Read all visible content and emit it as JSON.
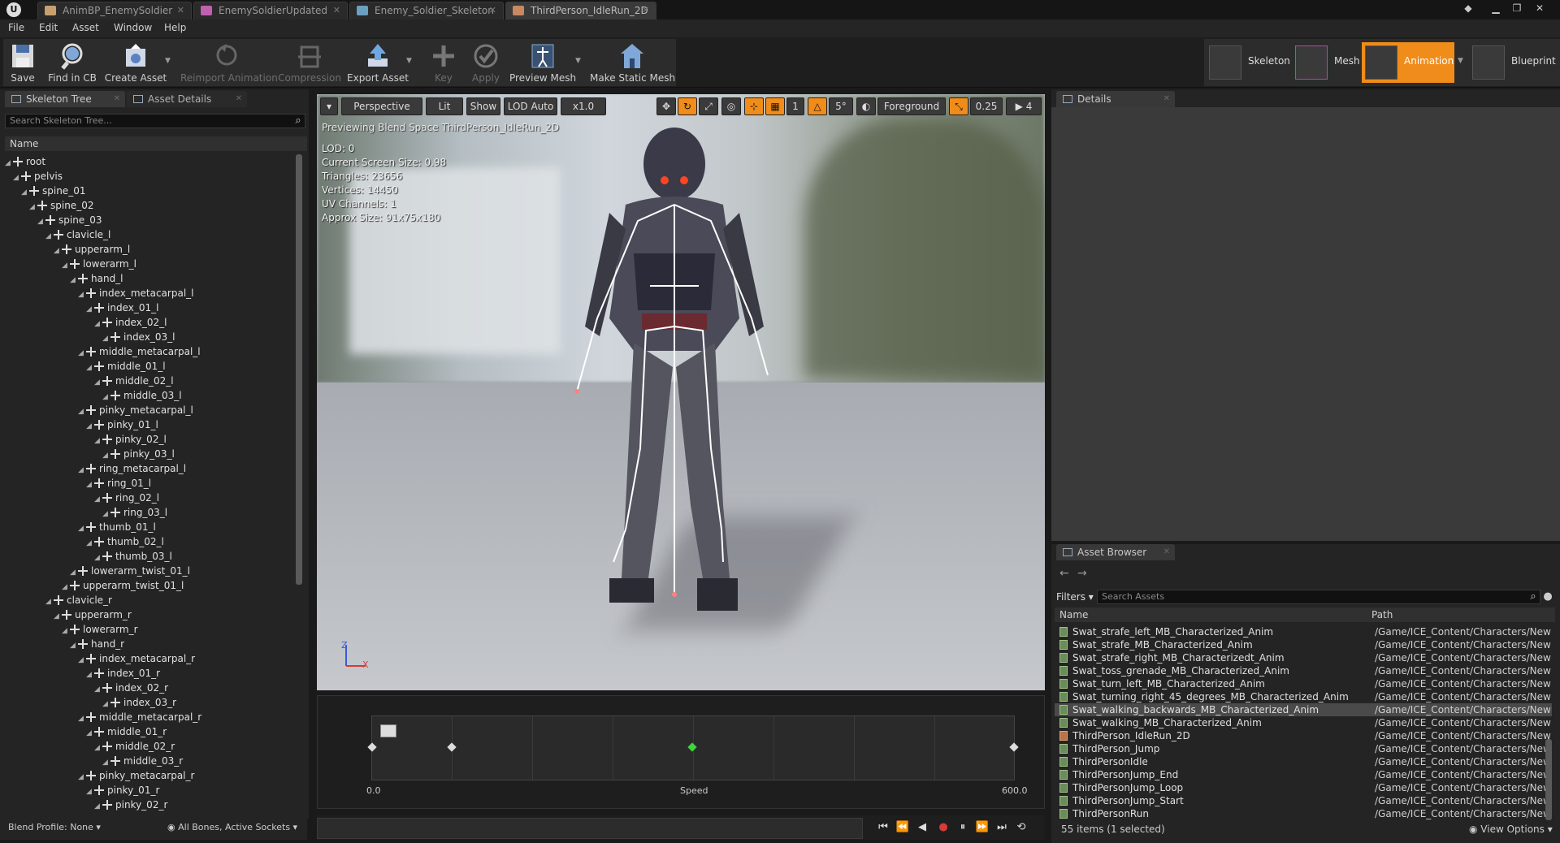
{
  "tabs": [
    {
      "label": "AnimBP_EnemySoldier",
      "color": "#c8a070"
    },
    {
      "label": "EnemySoldierUpdated",
      "color": "#c060b0"
    },
    {
      "label": "Enemy_Soldier_Skeleton",
      "color": "#6aa0c0"
    },
    {
      "label": "ThirdPerson_IdleRun_2D",
      "color": "#c88860"
    }
  ],
  "menu": [
    "File",
    "Edit",
    "Asset",
    "Window",
    "Help"
  ],
  "toolbar": {
    "save": "Save",
    "find_in_cb": "Find in CB",
    "create_asset": "Create Asset",
    "reimport": "Reimport Animation",
    "compression": "Compression",
    "export": "Export Asset",
    "key": "Key",
    "apply": "Apply",
    "preview_mesh": "Preview Mesh",
    "make_static_mesh": "Make Static Mesh"
  },
  "modes": {
    "skeleton": "Skeleton",
    "mesh": "Mesh",
    "animation": "Animation",
    "blueprint": "Blueprint"
  },
  "left_panel": {
    "tab_skeleton_tree": "Skeleton Tree",
    "tab_asset_details": "Asset Details",
    "search_placeholder": "Search Skeleton Tree...",
    "column_name": "Name",
    "bones": [
      {
        "name": "root",
        "depth": 0
      },
      {
        "name": "pelvis",
        "depth": 1
      },
      {
        "name": "spine_01",
        "depth": 2
      },
      {
        "name": "spine_02",
        "depth": 3
      },
      {
        "name": "spine_03",
        "depth": 4
      },
      {
        "name": "clavicle_l",
        "depth": 5
      },
      {
        "name": "upperarm_l",
        "depth": 6
      },
      {
        "name": "lowerarm_l",
        "depth": 7
      },
      {
        "name": "hand_l",
        "depth": 8
      },
      {
        "name": "index_metacarpal_l",
        "depth": 9
      },
      {
        "name": "index_01_l",
        "depth": 10
      },
      {
        "name": "index_02_l",
        "depth": 11
      },
      {
        "name": "index_03_l",
        "depth": 12
      },
      {
        "name": "middle_metacarpal_l",
        "depth": 9
      },
      {
        "name": "middle_01_l",
        "depth": 10
      },
      {
        "name": "middle_02_l",
        "depth": 11
      },
      {
        "name": "middle_03_l",
        "depth": 12
      },
      {
        "name": "pinky_metacarpal_l",
        "depth": 9
      },
      {
        "name": "pinky_01_l",
        "depth": 10
      },
      {
        "name": "pinky_02_l",
        "depth": 11
      },
      {
        "name": "pinky_03_l",
        "depth": 12
      },
      {
        "name": "ring_metacarpal_l",
        "depth": 9
      },
      {
        "name": "ring_01_l",
        "depth": 10
      },
      {
        "name": "ring_02_l",
        "depth": 11
      },
      {
        "name": "ring_03_l",
        "depth": 12
      },
      {
        "name": "thumb_01_l",
        "depth": 9
      },
      {
        "name": "thumb_02_l",
        "depth": 10
      },
      {
        "name": "thumb_03_l",
        "depth": 11
      },
      {
        "name": "lowerarm_twist_01_l",
        "depth": 8
      },
      {
        "name": "upperarm_twist_01_l",
        "depth": 7
      },
      {
        "name": "clavicle_r",
        "depth": 5
      },
      {
        "name": "upperarm_r",
        "depth": 6
      },
      {
        "name": "lowerarm_r",
        "depth": 7
      },
      {
        "name": "hand_r",
        "depth": 8
      },
      {
        "name": "index_metacarpal_r",
        "depth": 9
      },
      {
        "name": "index_01_r",
        "depth": 10
      },
      {
        "name": "index_02_r",
        "depth": 11
      },
      {
        "name": "index_03_r",
        "depth": 12
      },
      {
        "name": "middle_metacarpal_r",
        "depth": 9
      },
      {
        "name": "middle_01_r",
        "depth": 10
      },
      {
        "name": "middle_02_r",
        "depth": 11
      },
      {
        "name": "middle_03_r",
        "depth": 12
      },
      {
        "name": "pinky_metacarpal_r",
        "depth": 9
      },
      {
        "name": "pinky_01_r",
        "depth": 10
      },
      {
        "name": "pinky_02_r",
        "depth": 11
      }
    ],
    "blend_profile": "Blend Profile: None",
    "bone_filter": "All Bones, Active Sockets"
  },
  "viewport": {
    "perspective": "Perspective",
    "lit": "Lit",
    "show": "Show",
    "lod": "LOD Auto",
    "speed": "x1.0",
    "grid_snap": "1",
    "rot_snap": "5°",
    "foreground": "Foreground",
    "scale_snap": "0.25",
    "cam_speed": "4",
    "preview_text": "Previewing Blend Space ThirdPerson_IdleRun_2D",
    "stats": [
      "LOD: 0",
      "Current Screen Size: 0.98",
      "Triangles: 23656",
      "Vertices: 14450",
      "UV Channels: 1",
      "Approx Size: 91x75x180"
    ],
    "axis_z": "Z",
    "axis_x": "X"
  },
  "blend_space": {
    "min_label": "0.0",
    "axis_label": "Speed",
    "max_label": "600.0"
  },
  "details": {
    "tab": "Details"
  },
  "asset_browser": {
    "tab": "Asset Browser",
    "filters": "Filters",
    "search_placeholder": "Search Assets",
    "col_name": "Name",
    "col_path": "Path",
    "rows": [
      {
        "name": "Swat_strafe_left_MB_Characterized_Anim",
        "path": "/Game/ICE_Content/Characters/New",
        "type": "anim"
      },
      {
        "name": "Swat_strafe_MB_Characterized_Anim",
        "path": "/Game/ICE_Content/Characters/New",
        "type": "anim"
      },
      {
        "name": "Swat_strafe_right_MB_Characterizedt_Anim",
        "path": "/Game/ICE_Content/Characters/New",
        "type": "anim"
      },
      {
        "name": "Swat_toss_grenade_MB_Characterized_Anim",
        "path": "/Game/ICE_Content/Characters/New",
        "type": "anim"
      },
      {
        "name": "Swat_turn_left_MB_Characterized_Anim",
        "path": "/Game/ICE_Content/Characters/New",
        "type": "anim"
      },
      {
        "name": "Swat_turning_right_45_degrees_MB_Characterized_Anim",
        "path": "/Game/ICE_Content/Characters/New",
        "type": "anim"
      },
      {
        "name": "Swat_walking_backwards_MB_Characterized_Anim",
        "path": "/Game/ICE_Content/Characters/New",
        "type": "anim",
        "selected": true
      },
      {
        "name": "Swat_walking_MB_Characterized_Anim",
        "path": "/Game/ICE_Content/Characters/New",
        "type": "anim"
      },
      {
        "name": "ThirdPerson_IdleRun_2D",
        "path": "/Game/ICE_Content/Characters/New",
        "type": "blend"
      },
      {
        "name": "ThirdPerson_Jump",
        "path": "/Game/ICE_Content/Characters/New",
        "type": "anim"
      },
      {
        "name": "ThirdPersonIdle",
        "path": "/Game/ICE_Content/Characters/New",
        "type": "anim"
      },
      {
        "name": "ThirdPersonJump_End",
        "path": "/Game/ICE_Content/Characters/New",
        "type": "anim"
      },
      {
        "name": "ThirdPersonJump_Loop",
        "path": "/Game/ICE_Content/Characters/New",
        "type": "anim"
      },
      {
        "name": "ThirdPersonJump_Start",
        "path": "/Game/ICE_Content/Characters/New",
        "type": "anim"
      },
      {
        "name": "ThirdPersonRun",
        "path": "/Game/ICE_Content/Characters/New",
        "type": "anim"
      }
    ],
    "count": "55 items (1 selected)",
    "view_options": "View Options"
  }
}
